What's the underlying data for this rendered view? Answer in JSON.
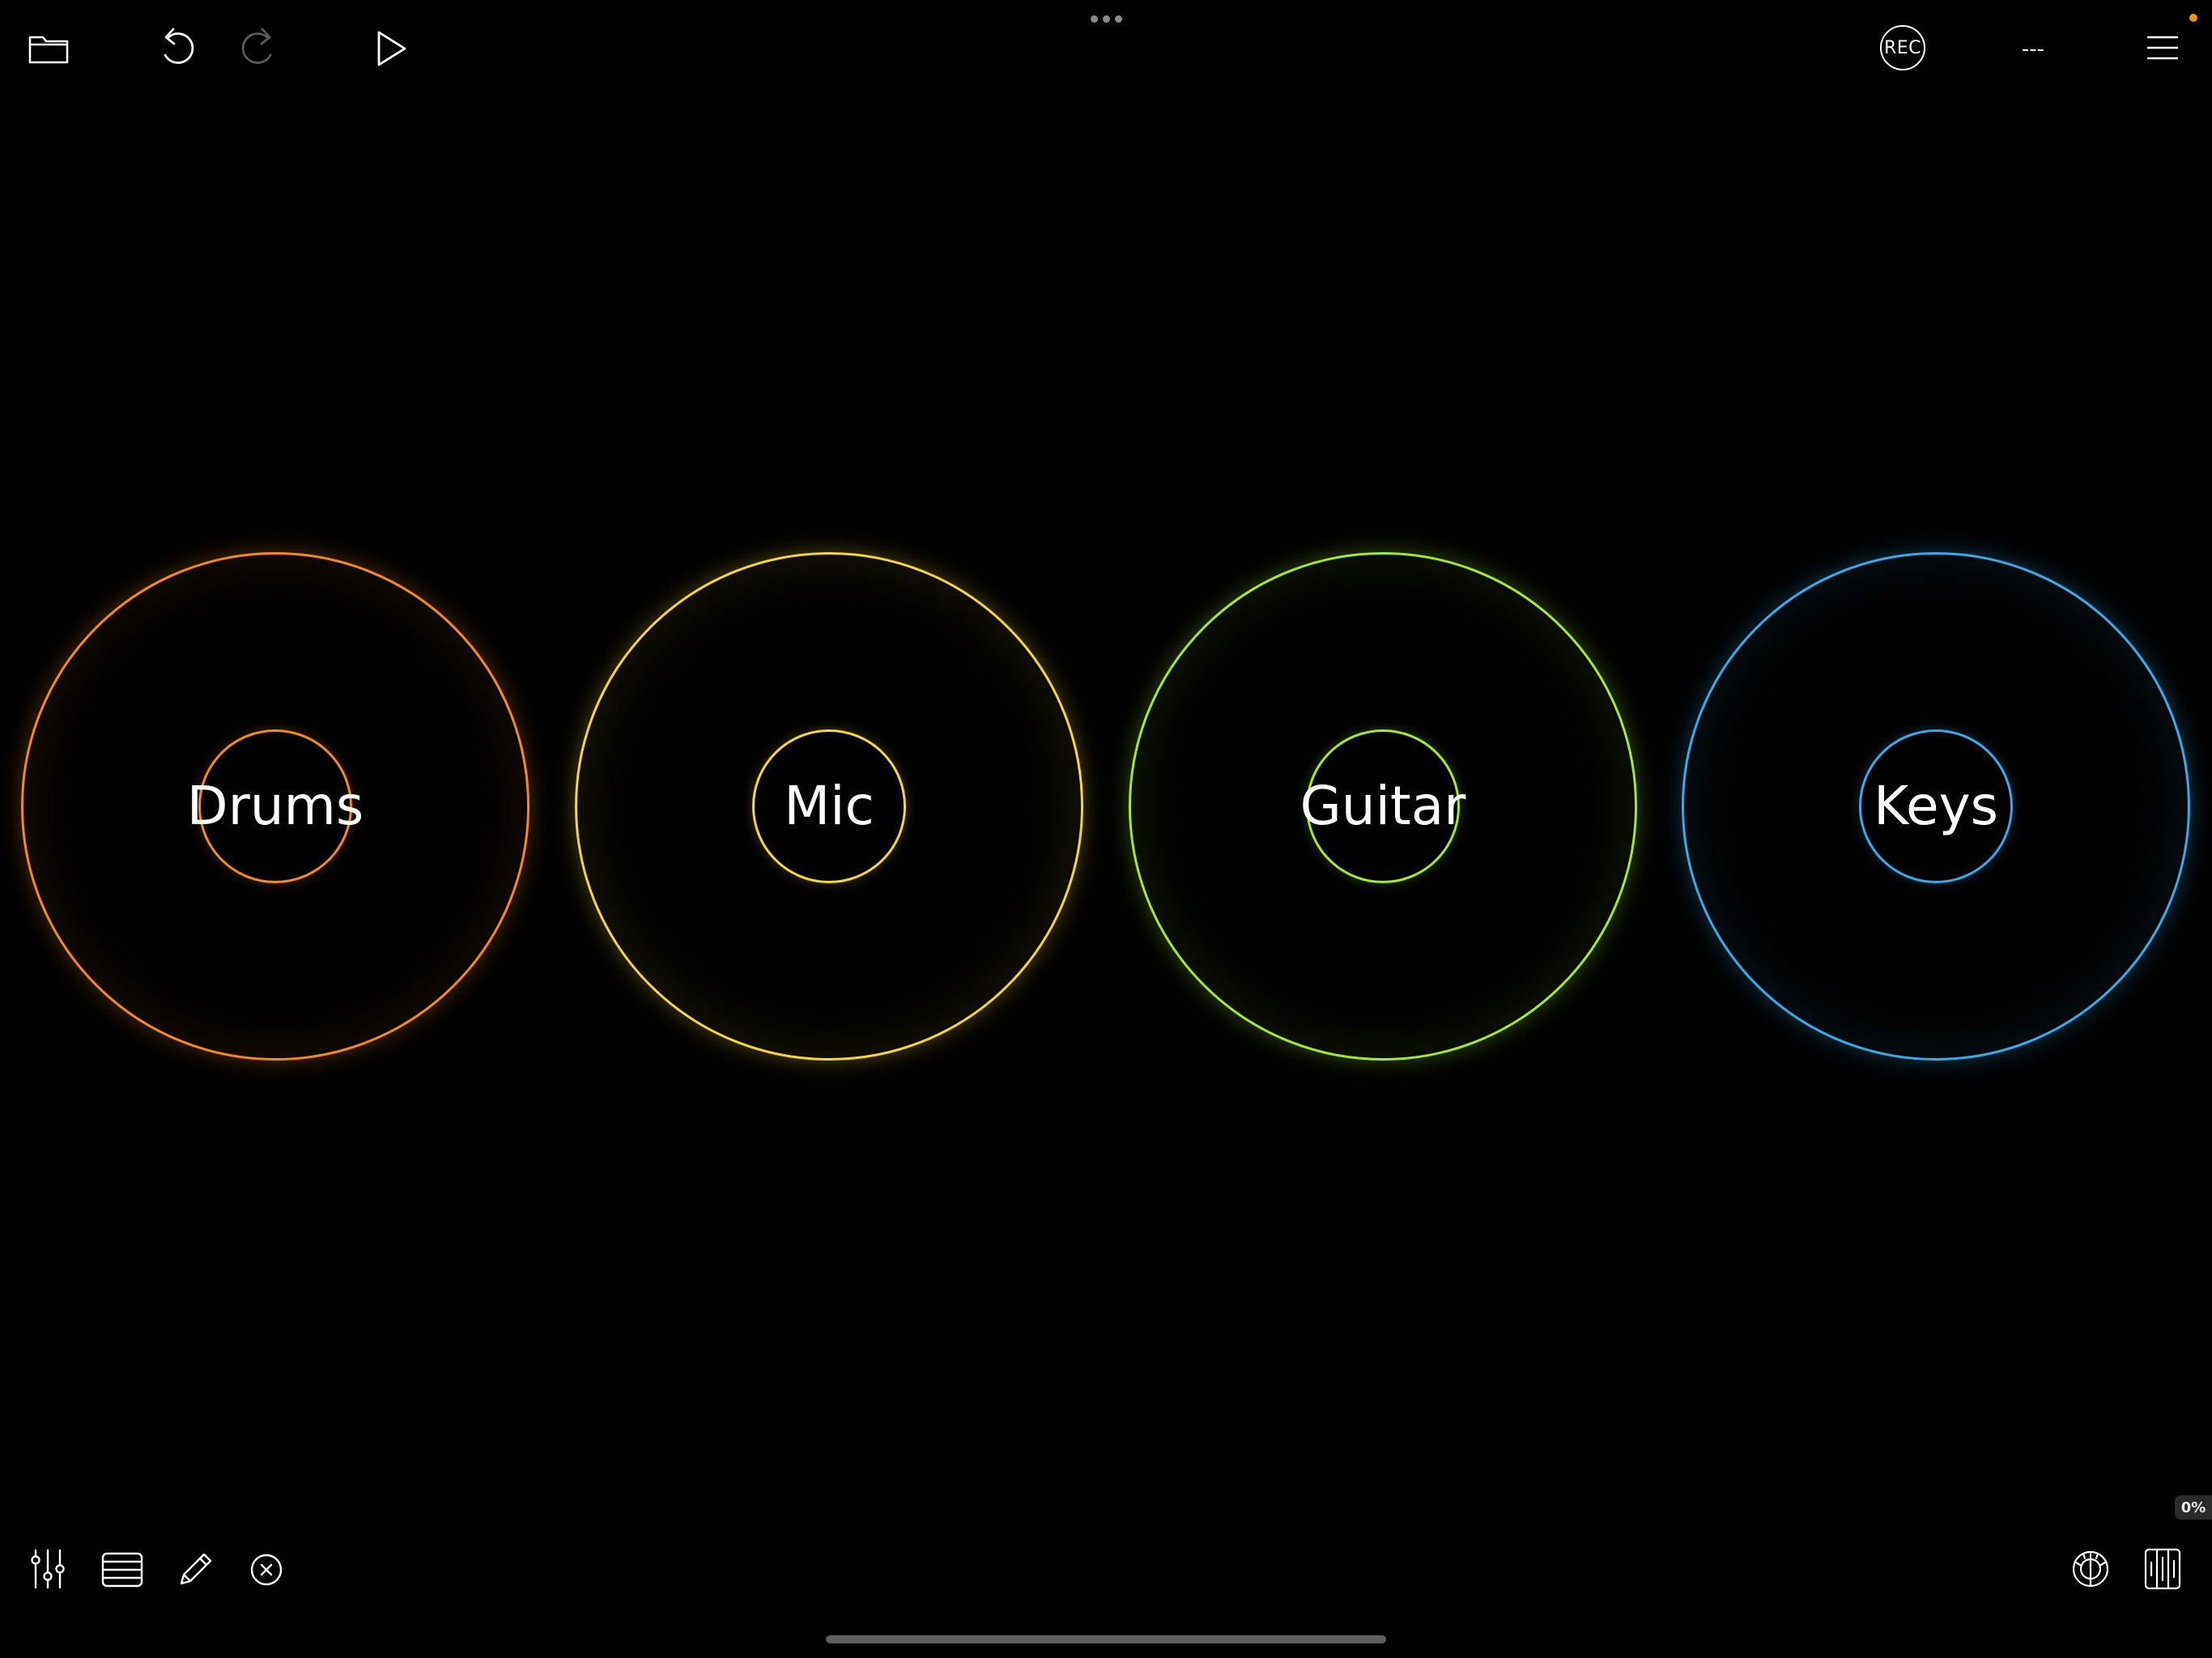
{
  "toolbar": {
    "rec_label": "REC",
    "tempo_display": "---"
  },
  "tracks": [
    {
      "label": "Drums",
      "color": "#f28a24"
    },
    {
      "label": "Mic",
      "color": "#f4d63a"
    },
    {
      "label": "Guitar",
      "color": "#a6e830"
    },
    {
      "label": "Keys",
      "color": "#3aa9e8"
    }
  ],
  "status": {
    "cpu_load": "0%",
    "notification_color": "#f0921c"
  },
  "icons": {
    "top_left": [
      "folder-icon",
      "undo-icon",
      "redo-icon",
      "play-icon"
    ],
    "top_right": [
      "rec-button",
      "tempo-display",
      "menu-icon"
    ],
    "bottom_left": [
      "mixer-icon",
      "track-list-icon",
      "edit-pencil-icon",
      "close-circle-icon"
    ],
    "bottom_right": [
      "tuner-icon",
      "split-view-icon"
    ]
  }
}
